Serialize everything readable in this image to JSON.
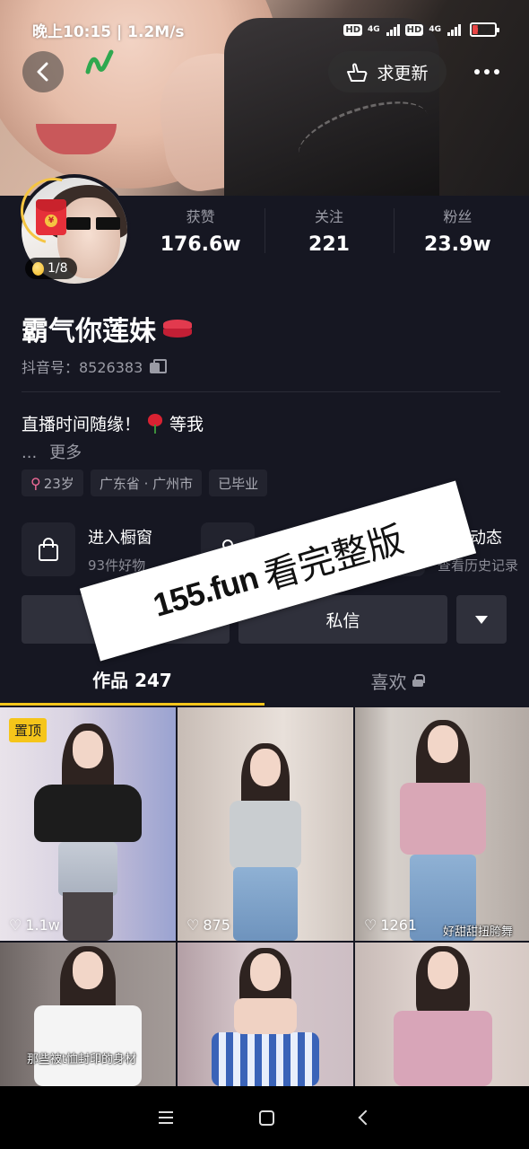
{
  "status_bar": {
    "time_speed": "晚上10:15 | 1.2M/s",
    "hd1": "HD",
    "net1": "4G",
    "hd2": "HD",
    "net2": "4G",
    "battery": "17"
  },
  "header": {
    "request_update": "求更新"
  },
  "profile": {
    "coin_progress": "1/8",
    "nickname": "霸气你莲妹",
    "account_label": "抖音号：8526383",
    "bio": "直播时间随缘！",
    "bio_tail": "等我",
    "ellipsis": "...",
    "more": "更多",
    "tags": {
      "age": "23岁",
      "location": "广东省 · 广州市",
      "education": "已毕业"
    }
  },
  "stats": [
    {
      "label": "获赞",
      "value": "176.6w"
    },
    {
      "label": "关注",
      "value": "221"
    },
    {
      "label": "粉丝",
      "value": "23.9w"
    }
  ],
  "features": [
    {
      "title": "进入橱窗",
      "sub": "93件好物",
      "icon": "shopping-bag-icon"
    },
    {
      "title": "粉",
      "sub": "",
      "icon": "person-icon"
    },
    {
      "title": "直播动态",
      "sub": "查看历史记录",
      "icon": "live-replay-icon"
    }
  ],
  "actions": {
    "followed": "已",
    "message": "私信"
  },
  "tabs": {
    "works": "作品 247",
    "likes": "喜欢"
  },
  "videos": [
    {
      "badge": "置顶",
      "likes": "1.1w",
      "caption": ""
    },
    {
      "badge": "",
      "likes": "875",
      "caption": ""
    },
    {
      "badge": "",
      "likes": "1261",
      "caption": "好甜甜扭胯舞"
    },
    {
      "badge": "",
      "likes": "",
      "caption": "那些被t恤封印的身材"
    },
    {
      "badge": "",
      "likes": "",
      "caption": ""
    },
    {
      "badge": "",
      "likes": "",
      "caption": ""
    }
  ],
  "watermark": {
    "url": "155.fun",
    "text": "看完整版"
  },
  "colors": {
    "background": "#161722",
    "accent": "#f5c51a",
    "tag_bg": "#22232e"
  }
}
